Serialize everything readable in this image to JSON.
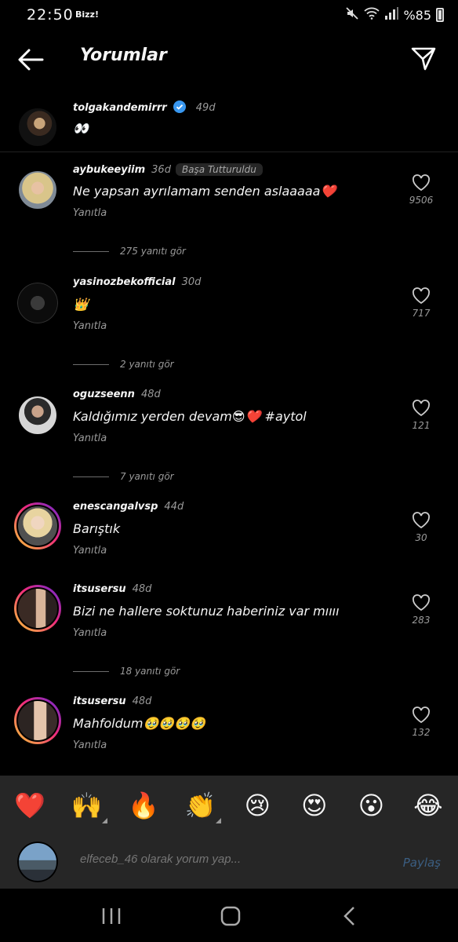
{
  "status": {
    "time": "22:50",
    "app": "Bizz!",
    "battery": "%85"
  },
  "header": {
    "title": "Yorumlar"
  },
  "caption": {
    "username": "tolgakandemirrr",
    "ago": "49d",
    "text": "👀"
  },
  "comments": [
    {
      "username": "aybukeeyiim",
      "ago": "36d",
      "pinned": "Başa Tutturuldu",
      "text": "Ne yapsan ayrılamam senden aslaaaaa❤️",
      "reply": "Yanıtla",
      "likes": "9506",
      "view_replies": "275 yanıtı gör"
    },
    {
      "username": "yasinozbekofficial",
      "ago": "30d",
      "text": "👑",
      "reply": "Yanıtla",
      "likes": "717",
      "view_replies": "2 yanıtı gör"
    },
    {
      "username": "oguzseenn",
      "ago": "48d",
      "text": "Kaldığımız yerden devam😎❤️ #aytol",
      "reply": "Yanıtla",
      "likes": "121",
      "view_replies": "7 yanıtı gör"
    },
    {
      "username": "enescangalvsp",
      "ago": "44d",
      "text": "Barıştık",
      "reply": "Yanıtla",
      "likes": "30"
    },
    {
      "username": "itsusersu",
      "ago": "48d",
      "text": "Bizi ne hallere soktunuz haberiniz var mıııı",
      "reply": "Yanıtla",
      "likes": "283",
      "view_replies": "18 yanıtı gör"
    },
    {
      "username": "itsusersu",
      "ago": "48d",
      "text": "Mahfoldum🥹🥹🥹🥹",
      "reply": "Yanıtla",
      "likes": "132"
    }
  ],
  "reactions": [
    "❤️",
    "🙌",
    "🔥",
    "👏",
    "😢",
    "😍",
    "😮",
    "😂"
  ],
  "composer": {
    "placeholder": "elfeceb_46 olarak yorum yap...",
    "share": "Paylaş"
  },
  "colors": {
    "verified": "#3897f0",
    "share_disabled": "#3b5e82",
    "panel": "#262626"
  },
  "icons": {
    "back": "arrow-left-icon",
    "send": "paper-plane-icon",
    "like": "heart-outline-icon",
    "verified": "verified-badge-icon"
  }
}
